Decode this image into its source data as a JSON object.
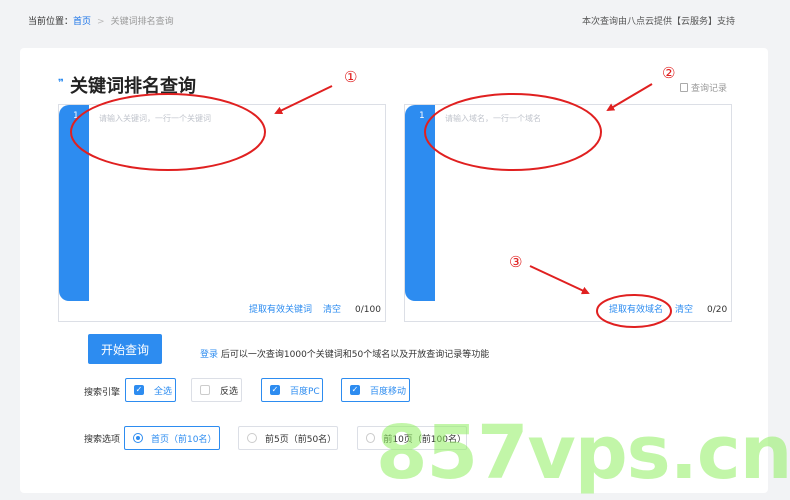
{
  "breadcrumb": {
    "prefix": "当前位置：",
    "home": "首页",
    "separator": ">",
    "current": "关键词排名查询"
  },
  "support_text": "本次查询由八点云提供【云服务】支持",
  "page": {
    "title": "关键词排名查询",
    "history": "查询记录"
  },
  "keywords_box": {
    "line_number": "1",
    "placeholder": "请输入关键词，一行一个关键词",
    "extract_link": "提取有效关键词",
    "clear_link": "清空",
    "count": "0/100"
  },
  "domains_box": {
    "line_number": "1",
    "placeholder": "请输入域名，一行一个域名",
    "extract_link": "提取有效域名",
    "clear_link": "清空",
    "count": "0/20"
  },
  "start_button": "开始查询",
  "login_tip": {
    "link": "登录",
    "text": "后可以一次查询1000个关键词和50个域名以及开放查询记录等功能"
  },
  "search_engine": {
    "label": "搜索引擎",
    "options": [
      {
        "label": "全选",
        "checked": true
      },
      {
        "label": "反选",
        "checked": false
      },
      {
        "label": "百度PC",
        "checked": true
      },
      {
        "label": "百度移动",
        "checked": true
      }
    ]
  },
  "search_option": {
    "label": "搜索选项",
    "options": [
      {
        "label": "首页（前10名）",
        "selected": true
      },
      {
        "label": "前5页（前50名）",
        "selected": false
      },
      {
        "label": "前10页（前100名）",
        "selected": false
      }
    ]
  },
  "annotations": [
    "①",
    "②",
    "③"
  ],
  "watermark": "857vps.cn",
  "colors": {
    "accent": "#2d8cf0",
    "annotation": "#e02020",
    "watermark": "#7ee85a"
  }
}
